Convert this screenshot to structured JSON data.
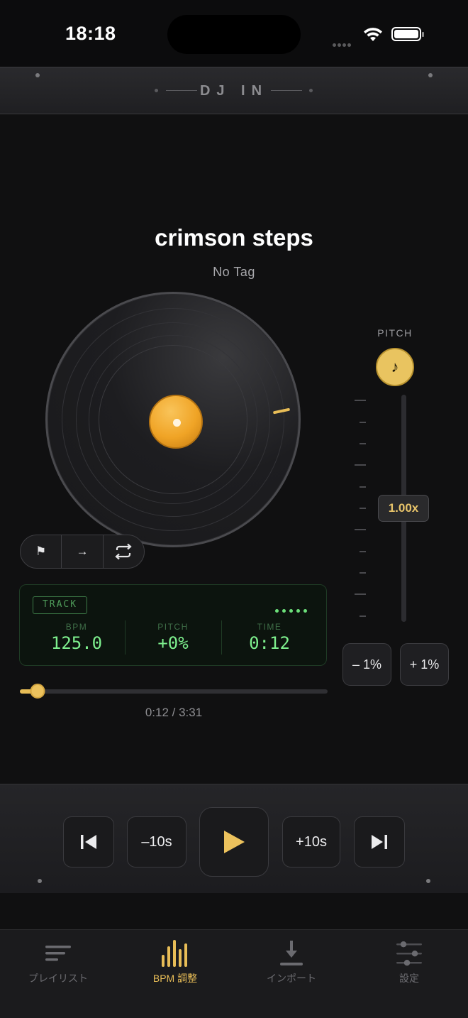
{
  "status_bar": {
    "time": "18:18"
  },
  "header": {
    "title": "DJ IN"
  },
  "track": {
    "title": "crimson steps",
    "tag": "No Tag"
  },
  "cue_controls": [
    {
      "icon": "flag-icon",
      "glyph": "⚑"
    },
    {
      "icon": "arrow-right-icon",
      "glyph": "→"
    },
    {
      "icon": "loop-icon",
      "glyph": ""
    }
  ],
  "lcd": {
    "badge": "TRACK",
    "bpm_label": "BPM",
    "bpm_value": "125.0",
    "pitch_label": "PITCH",
    "pitch_value": "+0%",
    "time_label": "TIME",
    "time_value": "0:12"
  },
  "seek": {
    "current": "0:12",
    "total": "3:31",
    "display": "0:12 / 3:31",
    "progress": 0.057
  },
  "pitch": {
    "label": "PITCH",
    "knob_glyph": "♪",
    "readout": "1.00x",
    "level": 0.5,
    "minus_label": "– 1%",
    "plus_label": "+ 1%"
  },
  "transport": {
    "rewind_label": "–10s",
    "forward_label": "+10s"
  },
  "tabs": [
    {
      "label": "プレイリスト",
      "icon": "playlist-icon",
      "active": false
    },
    {
      "label": "BPM 調整",
      "icon": "bpm-bars-icon",
      "active": true
    },
    {
      "label": "インポート",
      "icon": "import-icon",
      "active": false
    },
    {
      "label": "設定",
      "icon": "settings-sliders-icon",
      "active": false
    }
  ],
  "colors": {
    "accent": "#e8bd57",
    "lcd_green": "#7ef08e",
    "background": "#101011"
  }
}
